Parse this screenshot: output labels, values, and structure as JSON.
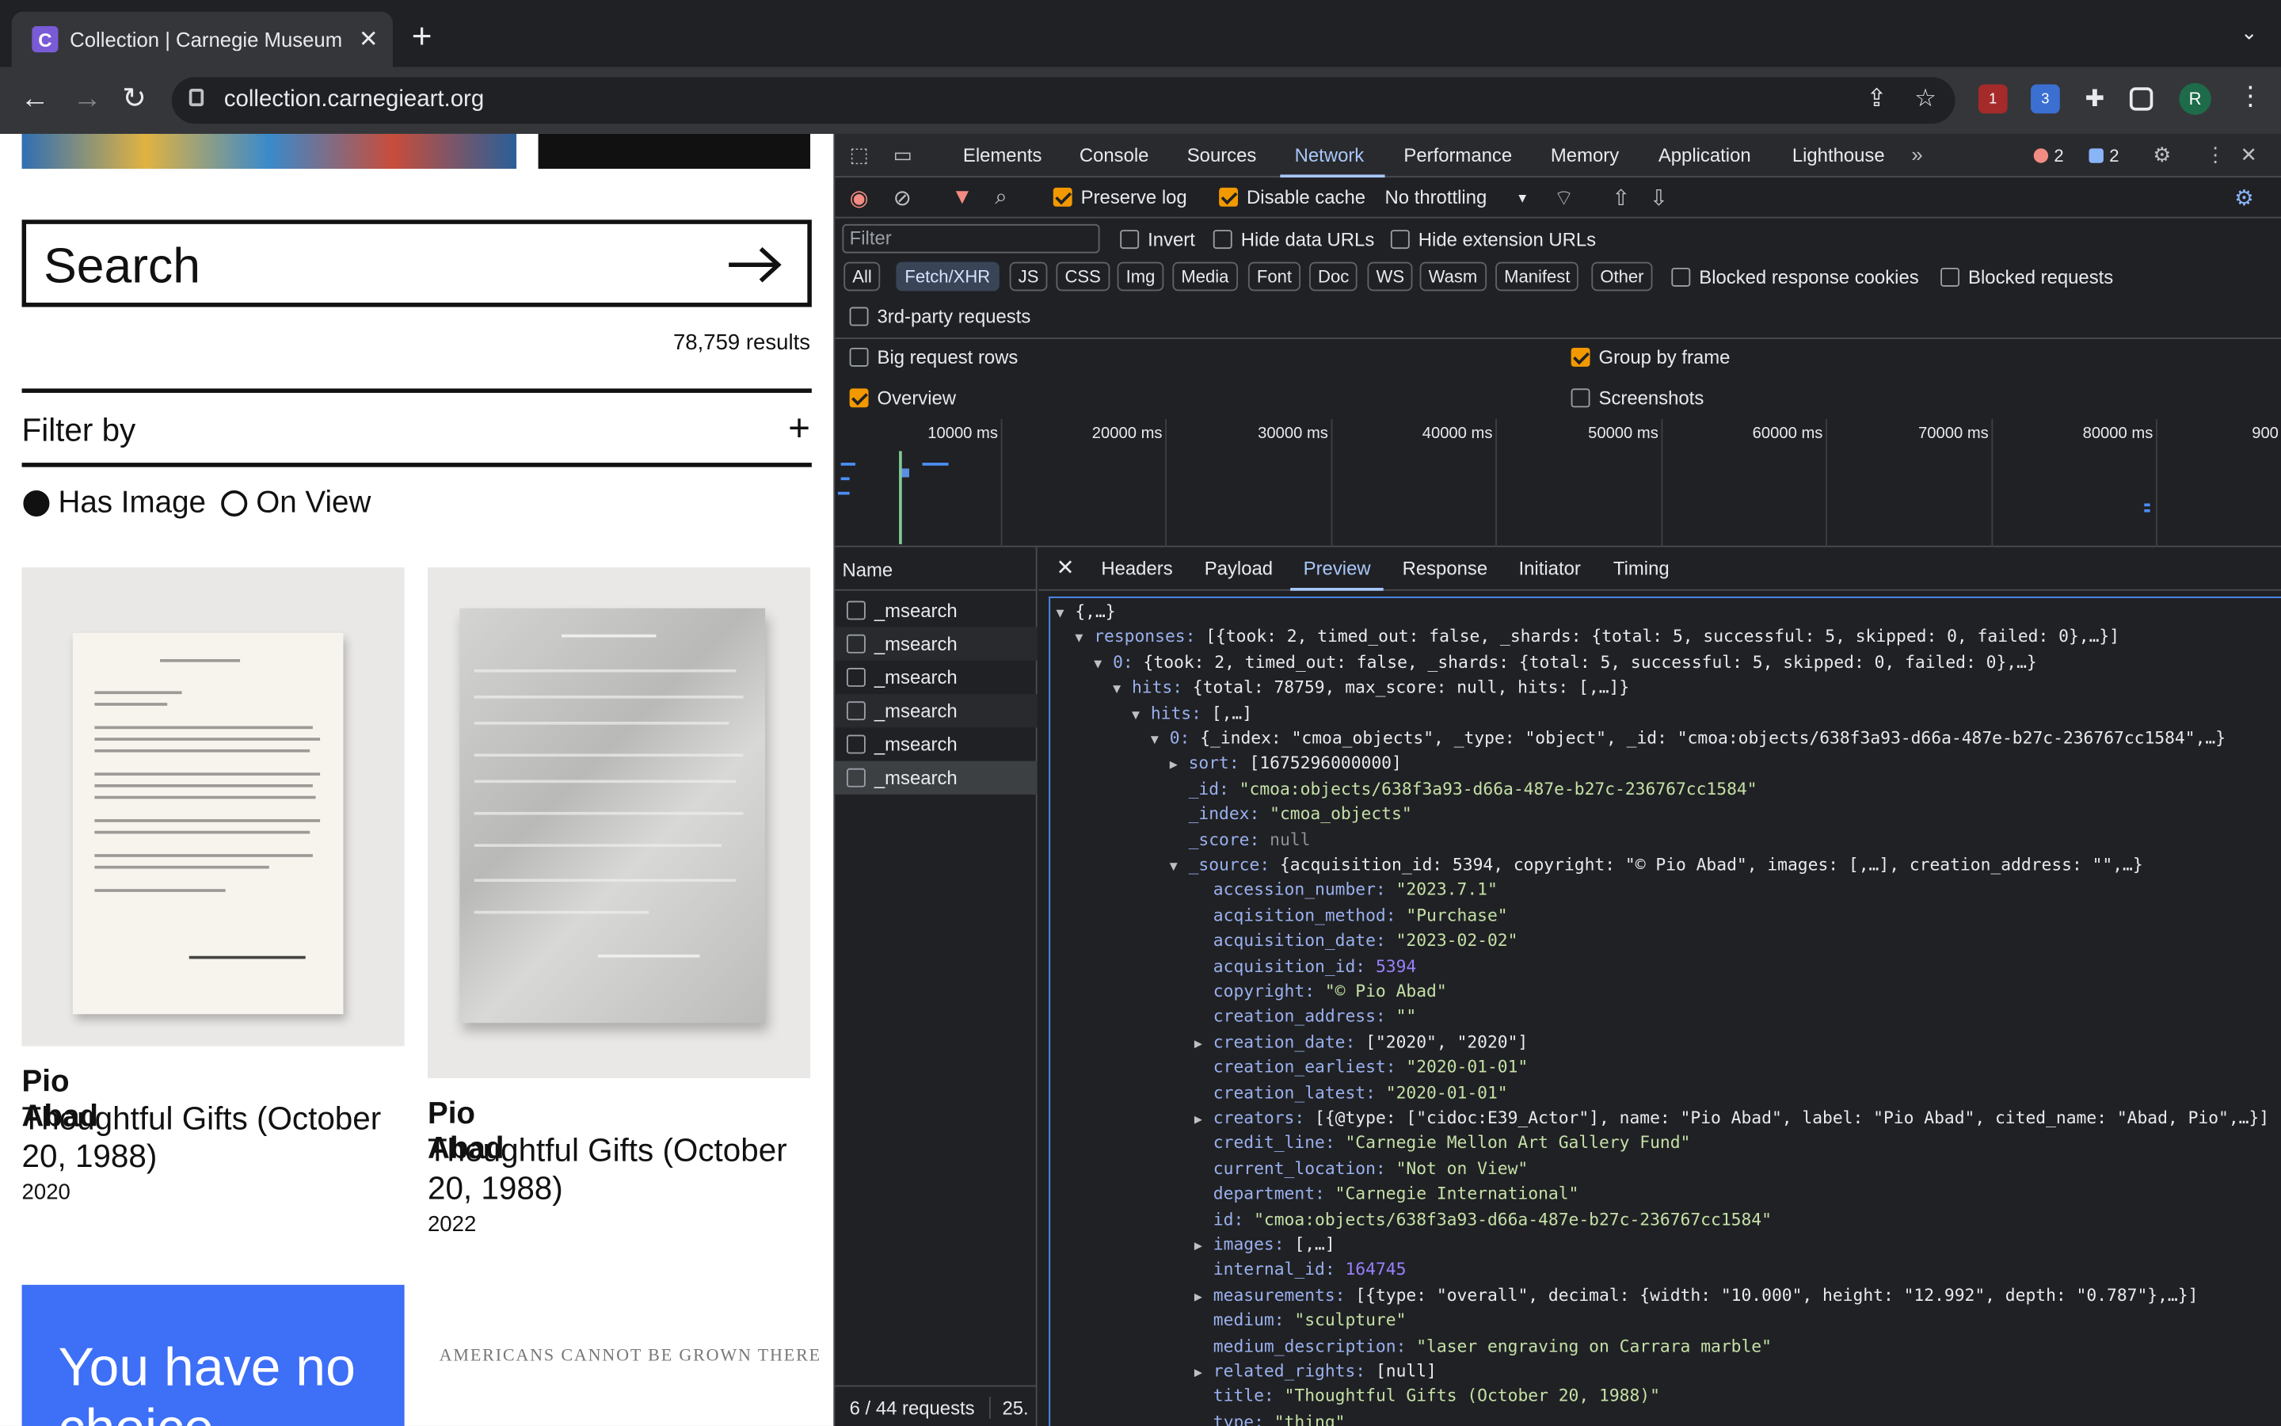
{
  "browser": {
    "tab_title": "Collection | Carnegie Museum",
    "favicon_letter": "C",
    "url": "collection.carnegieart.org",
    "ext_badges": [
      "1",
      "3"
    ],
    "avatar_letter": "R"
  },
  "page": {
    "search_label": "Search",
    "results": "78,759 results",
    "filter_by": "Filter by",
    "filters": [
      "Has Image",
      "On View"
    ],
    "cards": [
      {
        "artist": "Pio Abad",
        "title": "Thoughtful Gifts (October 20, 1988)",
        "year": "2020"
      },
      {
        "artist": "Pio Abad",
        "title": "Thoughtful Gifts (October 20, 1988)",
        "year": "2022"
      }
    ],
    "promo_text": "You have no choice",
    "quote_text": "AMERICANS CANNOT BE GROWN THERE"
  },
  "devtools": {
    "tabs": [
      "Elements",
      "Console",
      "Sources",
      "Network",
      "Performance",
      "Memory",
      "Application",
      "Lighthouse"
    ],
    "active_tab": "Network",
    "error_count": "2",
    "message_count": "2",
    "preserve_log": "Preserve log",
    "disable_cache": "Disable cache",
    "throttling": "No throttling",
    "filter_placeholder": "Filter",
    "invert": "Invert",
    "hide_data_urls": "Hide data URLs",
    "hide_ext_urls": "Hide extension URLs",
    "types": [
      "All",
      "Fetch/XHR",
      "JS",
      "CSS",
      "Img",
      "Media",
      "Font",
      "Doc",
      "WS",
      "Wasm",
      "Manifest",
      "Other"
    ],
    "blocked_cookies": "Blocked response cookies",
    "blocked_requests": "Blocked requests",
    "third_party": "3rd-party requests",
    "big_rows": "Big request rows",
    "group_by_frame": "Group by frame",
    "overview": "Overview",
    "screenshots": "Screenshots",
    "timeline_ticks": [
      "10000 ms",
      "20000 ms",
      "30000 ms",
      "40000 ms",
      "50000 ms",
      "60000 ms",
      "70000 ms",
      "80000 ms",
      "900"
    ],
    "name_header": "Name",
    "requests": [
      "_msearch",
      "_msearch",
      "_msearch",
      "_msearch",
      "_msearch",
      "_msearch"
    ],
    "footer": "6 / 44 requests",
    "footer_extra": "25.",
    "detail_tabs": [
      "Headers",
      "Payload",
      "Preview",
      "Response",
      "Initiator",
      "Timing"
    ],
    "active_detail_tab": "Preview"
  },
  "preview_lines": [
    {
      "i": 0,
      "tri": "▼",
      "k": "",
      "v": "{,…}"
    },
    {
      "i": 1,
      "tri": "▼",
      "k": "responses",
      "v": "[{took: 2, timed_out: false, _shards: {total: 5, successful: 5, skipped: 0, failed: 0},…}]"
    },
    {
      "i": 2,
      "tri": "▼",
      "k": "0",
      "v": "{took: 2, timed_out: false, _shards: {total: 5, successful: 5, skipped: 0, failed: 0},…}"
    },
    {
      "i": 3,
      "tri": "▼",
      "k": "hits",
      "v": "{total: 78759, max_score: null, hits: [,…]}"
    },
    {
      "i": 4,
      "tri": "▼",
      "k": "hits",
      "v": "[,…]"
    },
    {
      "i": 5,
      "tri": "▼",
      "k": "0",
      "v": "{_index: \"cmoa_objects\", _type: \"object\", _id: \"cmoa:objects/638f3a93-d66a-487e-b27c-236767cc1584\",…}"
    },
    {
      "i": 6,
      "tri": "▶",
      "k": "sort",
      "v": "[1675296000000]"
    },
    {
      "i": 6,
      "tri": "",
      "k": "_id",
      "v": "\"cmoa:objects/638f3a93-d66a-487e-b27c-236767cc1584\"",
      "t": "s"
    },
    {
      "i": 6,
      "tri": "",
      "k": "_index",
      "v": "\"cmoa_objects\"",
      "t": "s"
    },
    {
      "i": 6,
      "tri": "",
      "k": "_score",
      "v": "null",
      "t": "nl"
    },
    {
      "i": 6,
      "tri": "▼",
      "k": "_source",
      "v": "{acquisition_id: 5394, copyright: \"© Pio Abad\", images: [,…], creation_address: \"\",…}"
    },
    {
      "i": 7,
      "tri": "",
      "k": "accession_number",
      "v": "\"2023.7.1\"",
      "t": "s"
    },
    {
      "i": 7,
      "tri": "",
      "k": "acqisition_method",
      "v": "\"Purchase\"",
      "t": "s"
    },
    {
      "i": 7,
      "tri": "",
      "k": "acquisition_date",
      "v": "\"2023-02-02\"",
      "t": "s"
    },
    {
      "i": 7,
      "tri": "",
      "k": "acquisition_id",
      "v": "5394",
      "t": "n"
    },
    {
      "i": 7,
      "tri": "",
      "k": "copyright",
      "v": "\"© Pio Abad\"",
      "t": "s"
    },
    {
      "i": 7,
      "tri": "",
      "k": "creation_address",
      "v": "\"\"",
      "t": "s"
    },
    {
      "i": 7,
      "tri": "▶",
      "k": "creation_date",
      "v": "[\"2020\", \"2020\"]"
    },
    {
      "i": 7,
      "tri": "",
      "k": "creation_earliest",
      "v": "\"2020-01-01\"",
      "t": "s"
    },
    {
      "i": 7,
      "tri": "",
      "k": "creation_latest",
      "v": "\"2020-01-01\"",
      "t": "s"
    },
    {
      "i": 7,
      "tri": "▶",
      "k": "creators",
      "v": "[{@type: [\"cidoc:E39_Actor\"], name: \"Pio Abad\", label: \"Pio Abad\", cited_name: \"Abad, Pio\",…}]"
    },
    {
      "i": 7,
      "tri": "",
      "k": "credit_line",
      "v": "\"Carnegie Mellon Art Gallery Fund\"",
      "t": "s"
    },
    {
      "i": 7,
      "tri": "",
      "k": "current_location",
      "v": "\"Not on View\"",
      "t": "s"
    },
    {
      "i": 7,
      "tri": "",
      "k": "department",
      "v": "\"Carnegie International\"",
      "t": "s"
    },
    {
      "i": 7,
      "tri": "",
      "k": "id",
      "v": "\"cmoa:objects/638f3a93-d66a-487e-b27c-236767cc1584\"",
      "t": "s"
    },
    {
      "i": 7,
      "tri": "▶",
      "k": "images",
      "v": "[,…]"
    },
    {
      "i": 7,
      "tri": "",
      "k": "internal_id",
      "v": "164745",
      "t": "n"
    },
    {
      "i": 7,
      "tri": "▶",
      "k": "measurements",
      "v": "[{type: \"overall\", decimal: {width: \"10.000\", height: \"12.992\", depth: \"0.787\"},…}]"
    },
    {
      "i": 7,
      "tri": "",
      "k": "medium",
      "v": "\"sculpture\"",
      "t": "s"
    },
    {
      "i": 7,
      "tri": "",
      "k": "medium_description",
      "v": "\"laser engraving on Carrara marble\"",
      "t": "s"
    },
    {
      "i": 7,
      "tri": "▶",
      "k": "related_rights",
      "v": "[null]"
    },
    {
      "i": 7,
      "tri": "",
      "k": "title",
      "v": "\"Thoughtful Gifts (October 20, 1988)\"",
      "t": "s"
    },
    {
      "i": 7,
      "tri": "",
      "k": "type",
      "v": "\"thing\"",
      "t": "s"
    }
  ]
}
